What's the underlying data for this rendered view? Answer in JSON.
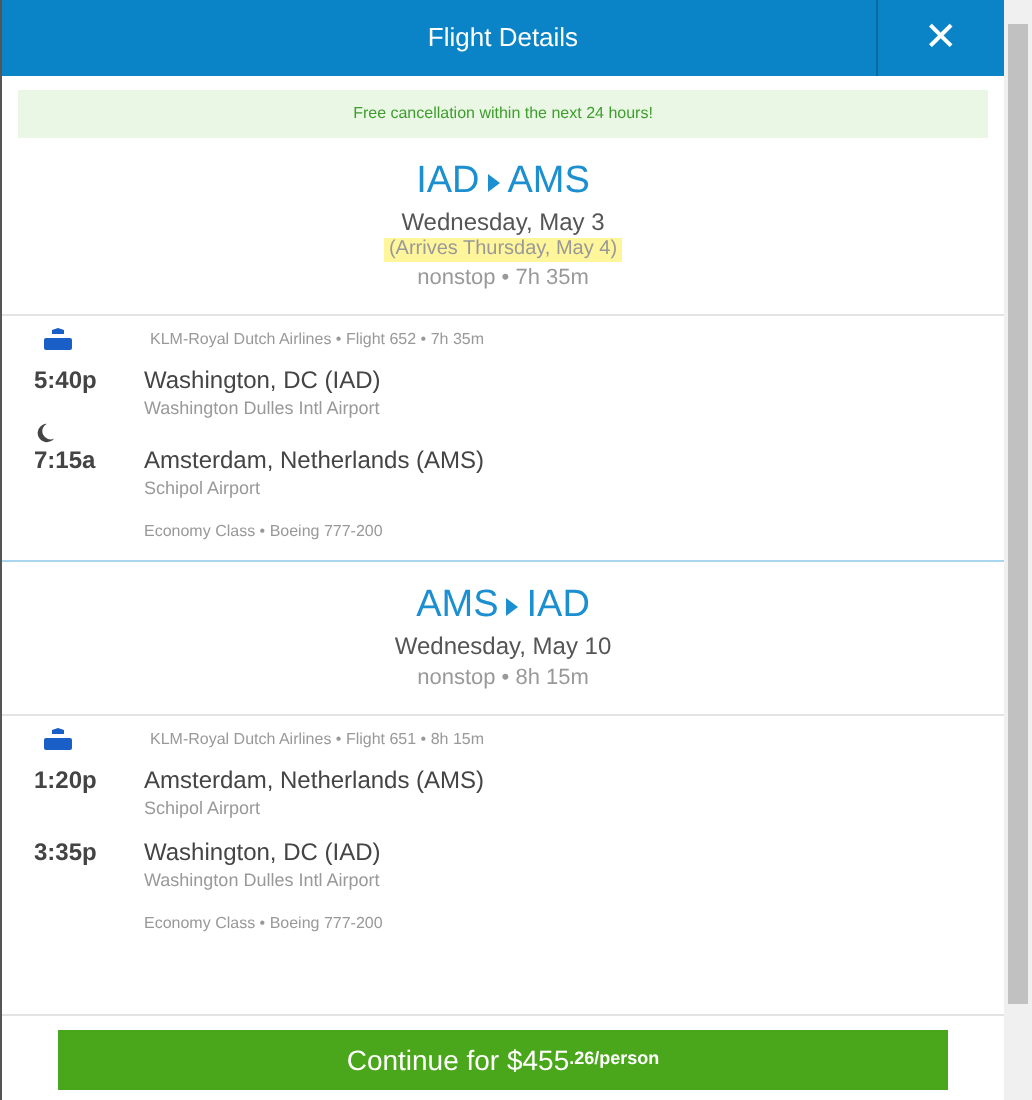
{
  "header": {
    "title": "Flight Details",
    "close": "✕"
  },
  "banner": "Free cancellation within the next 24 hours!",
  "legs": [
    {
      "from": "IAD",
      "to": "AMS",
      "date": "Wednesday, May 3",
      "arrives": "(Arrives Thursday, May 4)",
      "summary": "nonstop • 7h 35m",
      "airline": "KLM-Royal Dutch Airlines • Flight 652 • 7h 35m",
      "overnight": true,
      "stops": [
        {
          "time": "5:40p",
          "city": "Washington, DC (IAD)",
          "airport": "Washington Dulles Intl Airport"
        },
        {
          "time": "7:15a",
          "city": "Amsterdam, Netherlands (AMS)",
          "airport": "Schipol Airport"
        }
      ],
      "cabin": "Economy Class • Boeing 777-200"
    },
    {
      "from": "AMS",
      "to": "IAD",
      "date": "Wednesday, May 10",
      "summary": "nonstop • 8h 15m",
      "airline": "KLM-Royal Dutch Airlines • Flight 651 • 8h 15m",
      "overnight": false,
      "stops": [
        {
          "time": "1:20p",
          "city": "Amsterdam, Netherlands (AMS)",
          "airport": "Schipol Airport"
        },
        {
          "time": "3:35p",
          "city": "Washington, DC (IAD)",
          "airport": "Washington Dulles Intl Airport"
        }
      ],
      "cabin": "Economy Class • Boeing 777-200"
    }
  ],
  "continue": {
    "label": "Continue for $455",
    "suffix": ".26/person"
  }
}
